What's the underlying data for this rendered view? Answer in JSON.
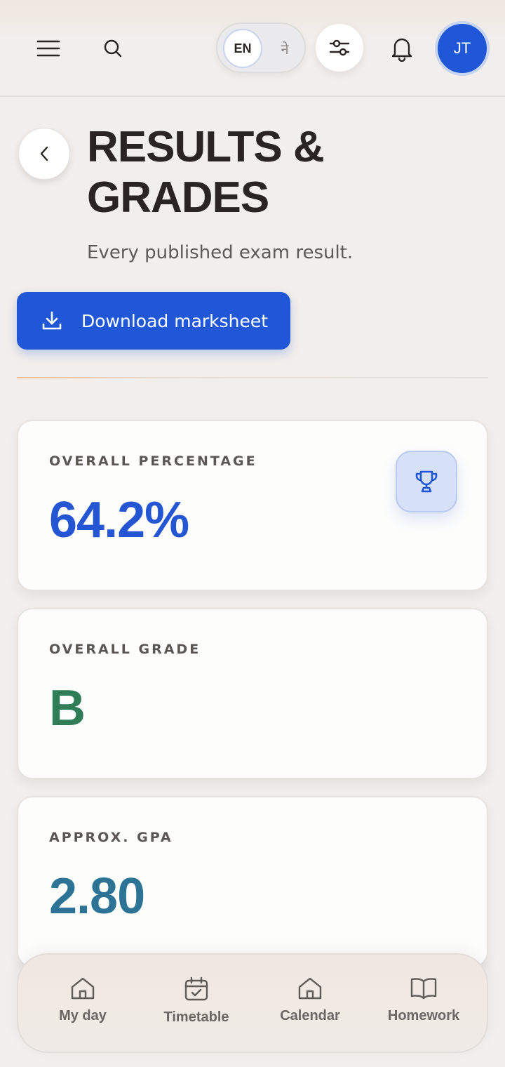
{
  "header": {
    "lang_en": "EN",
    "lang_ne": "ने",
    "avatar_initials": "JT"
  },
  "page": {
    "title_line1": "RESULTS &",
    "title_line2": "GRADES",
    "subtitle": "Every published exam result.",
    "download_label": "Download marksheet"
  },
  "stats": [
    {
      "label": "OVERALL PERCENTAGE",
      "value": "64.2%",
      "color": "#2456d3",
      "icon": "trophy-icon"
    },
    {
      "label": "OVERALL GRADE",
      "value": "B",
      "color": "#2e7d57"
    },
    {
      "label": "APPROX. GPA",
      "value": "2.80",
      "color": "#2d7396"
    }
  ],
  "bottom_nav": [
    {
      "label": "My day",
      "icon": "home-icon"
    },
    {
      "label": "Timetable",
      "icon": "calendar-check-icon"
    },
    {
      "label": "Calendar",
      "icon": "home-icon"
    },
    {
      "label": "Homework",
      "icon": "book-icon"
    }
  ],
  "colors": {
    "primary": "#1f57d6",
    "background": "#f2eeeb"
  }
}
